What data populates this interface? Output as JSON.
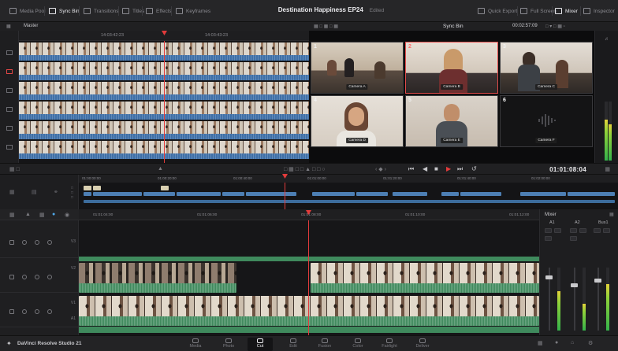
{
  "topbar": {
    "items": [
      {
        "label": "Media Pool"
      },
      {
        "label": "Sync Bin"
      },
      {
        "label": "Transitions"
      },
      {
        "label": "Titles"
      },
      {
        "label": "Effects"
      },
      {
        "label": "Keyframes"
      }
    ],
    "project_title": "Destination Happiness EP24",
    "project_status": "Edited",
    "right_items": [
      {
        "label": "Quick Export"
      },
      {
        "label": "Full Screen"
      },
      {
        "label": "Mixer"
      },
      {
        "label": "Inspector"
      }
    ]
  },
  "source": {
    "header": "Master",
    "ruler_marks": [
      "14:03:42:23",
      "14:03:43:23"
    ]
  },
  "sync_bin": {
    "title": "Sync Bin",
    "timecode": "00:02:57:09",
    "cameras": [
      {
        "num": "1",
        "label": "Camera A"
      },
      {
        "num": "2",
        "label": "Camera B"
      },
      {
        "num": "3",
        "label": "Camera C"
      },
      {
        "num": "4",
        "label": "Camera D"
      },
      {
        "num": "5",
        "label": "Camera E"
      },
      {
        "num": "6",
        "label": "Camera F"
      }
    ]
  },
  "transport": {
    "timecode": "01:01:08:04"
  },
  "mini_timeline": {
    "ruler_marks": [
      "01:00:00:00",
      "01:00:20:00",
      "01:00:40:00",
      "01:01:00:00",
      "01:01:20:00",
      "01:01:40:00",
      "01:02:00:00"
    ]
  },
  "timeline": {
    "ruler_marks": [
      "01:01:04:00",
      "01:01:06:00",
      "01:01:08:00",
      "01:01:10:00",
      "01:01:12:00"
    ],
    "tracks": [
      {
        "tag": "V3"
      },
      {
        "tag": "V2"
      },
      {
        "tag": "V1"
      },
      {
        "tag": "A1"
      }
    ]
  },
  "mixer": {
    "title": "Mixer",
    "channels": [
      {
        "name": "A1",
        "level": 0.62
      },
      {
        "name": "A2",
        "level": 0.42
      },
      {
        "name": "Bus1",
        "level": 0.74
      }
    ]
  },
  "pagebar": {
    "app_name": "DaVinci Resolve Studio 21",
    "pages": [
      {
        "label": "Media"
      },
      {
        "label": "Photo"
      },
      {
        "label": "Cut"
      },
      {
        "label": "Edit"
      },
      {
        "label": "Fusion"
      },
      {
        "label": "Color"
      },
      {
        "label": "Fairlight"
      },
      {
        "label": "Deliver"
      }
    ],
    "active_page": "Cut"
  },
  "colors": {
    "playhead": "#e23b3b",
    "video_audio": "#3f70a8",
    "timeline_audio": "#3f8a5d",
    "selected_camera": "#e14b4b"
  }
}
